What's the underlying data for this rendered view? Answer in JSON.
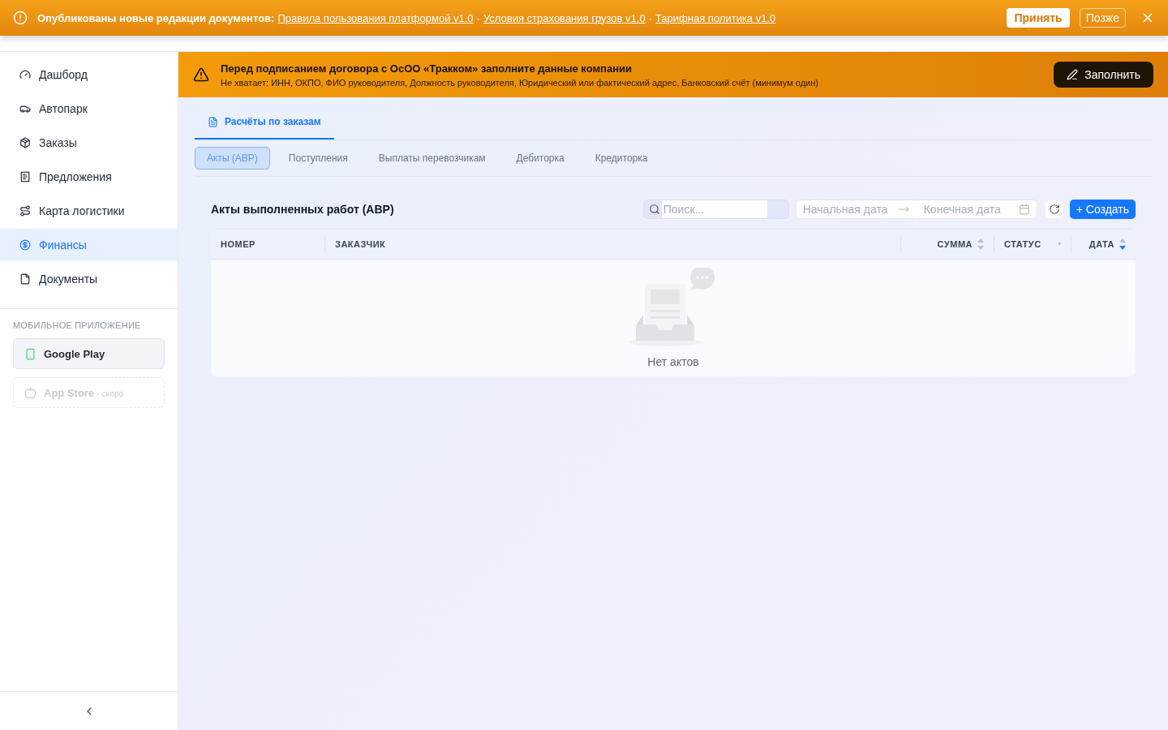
{
  "notice_banner": {
    "label": "Опубликованы новые редакции документов:",
    "links": [
      "Правила пользования платформой v1.0",
      "Условия страхования грузов v1.0",
      "Тарифная политика v1.0"
    ],
    "separator": "·",
    "accept": "Принять",
    "later": "Позже"
  },
  "sidebar": {
    "items": [
      {
        "label": "Дашборд",
        "selected": false
      },
      {
        "label": "Автопарк",
        "selected": false
      },
      {
        "label": "Заказы",
        "selected": false
      },
      {
        "label": "Предложения",
        "selected": false
      },
      {
        "label": "Карта логистики",
        "selected": false
      },
      {
        "label": "Финансы",
        "selected": true
      },
      {
        "label": "Документы",
        "selected": false
      }
    ],
    "mobile_title": "МОБИЛЬНОЕ ПРИЛОЖЕНИЕ",
    "stores": [
      {
        "label": "Google Play",
        "disabled": false
      },
      {
        "label": "App Store",
        "note": "· скоро",
        "disabled": true
      }
    ]
  },
  "company_alert": {
    "title": "Перед подписанием договора с ОсОО «Тракком» заполните данные компании",
    "text": "Не хватает: ИНН, ОКПО, ФИО руководителя, Должность руководителя, Юридический или фактический адрес, Банковский счёт (минимум один)",
    "button": "Заполнить"
  },
  "page_tabs": [
    {
      "label": "Расчёты по заказам",
      "selected": true
    }
  ],
  "sub_tabs": [
    {
      "label": "Акты (АВР)",
      "selected": true
    },
    {
      "label": "Поступления",
      "selected": false
    },
    {
      "label": "Выплаты перевозчикам",
      "selected": false
    },
    {
      "label": "Дебиторка",
      "selected": false
    },
    {
      "label": "Кредиторка",
      "selected": false
    }
  ],
  "panel": {
    "title": "Акты выполненных работ (АВР)",
    "search": {
      "placeholder": "Поиск..."
    },
    "date_range": {
      "start_placeholder": "Начальная дата",
      "end_placeholder": "Конечная дата"
    },
    "create": "+ Создать"
  },
  "table": {
    "columns": [
      {
        "label": "НОМЕР",
        "kind": "plain"
      },
      {
        "label": "ЗАКАЗЧИК",
        "kind": "plain"
      },
      {
        "label": "СУММА",
        "kind": "sort",
        "sorted_desc": false
      },
      {
        "label": "СТАТУС",
        "kind": "filter"
      },
      {
        "label": "ДАТА",
        "kind": "sort",
        "sorted_desc": true
      }
    ],
    "empty_text": "Нет актов"
  }
}
